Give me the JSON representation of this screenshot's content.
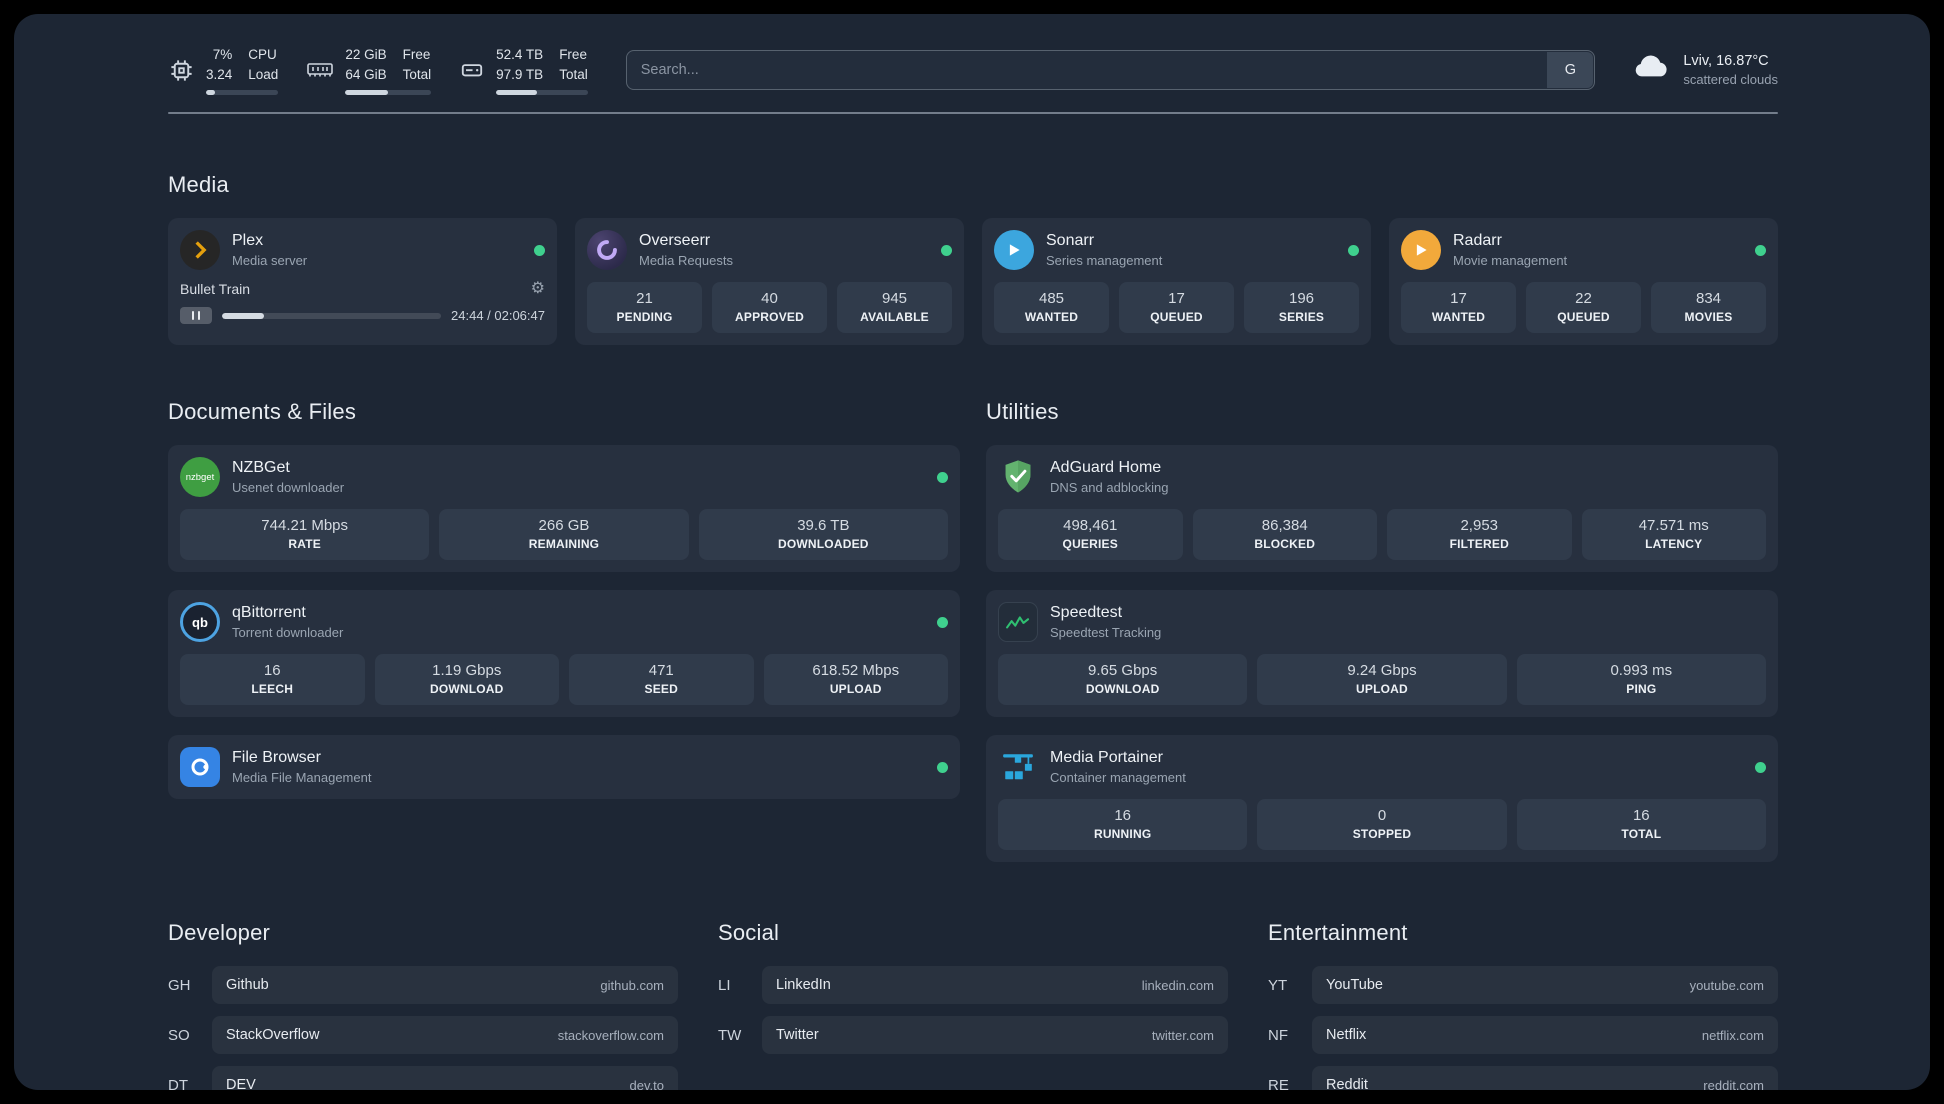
{
  "colors": {
    "status_online": "#3fd08e"
  },
  "topbar": {
    "cpu": {
      "icon": "cpu-icon",
      "line1": "7%",
      "line2": "3.24",
      "label1": "CPU",
      "label2": "Load",
      "progress": 12
    },
    "memory": {
      "icon": "memory-icon",
      "line1": "22 GiB",
      "line2": "64 GiB",
      "label1": "Free",
      "label2": "Total",
      "progress": 50
    },
    "disk": {
      "icon": "disk-icon",
      "line1": "52.4 TB",
      "line2": "97.9 TB",
      "label1": "Free",
      "label2": "Total",
      "progress": 45
    },
    "search": {
      "placeholder": "Search...",
      "provider_label": "G"
    },
    "weather": {
      "icon": "cloud-icon",
      "location": "Lviv, 16.87°C",
      "condition": "scattered clouds"
    }
  },
  "sections": {
    "media": {
      "title": "Media",
      "cards": [
        {
          "name": "Plex",
          "desc": "Media server",
          "icon": "plex-icon",
          "status": "online",
          "player": {
            "track": "Bullet Train",
            "time": "24:44 / 02:06:47",
            "progress": 19
          }
        },
        {
          "name": "Overseerr",
          "desc": "Media Requests",
          "icon": "overseerr-icon",
          "status": "online",
          "stats": [
            {
              "value": "21",
              "label": "PENDING"
            },
            {
              "value": "40",
              "label": "APPROVED"
            },
            {
              "value": "945",
              "label": "AVAILABLE"
            }
          ]
        },
        {
          "name": "Sonarr",
          "desc": "Series management",
          "icon": "sonarr-icon",
          "status": "online",
          "stats": [
            {
              "value": "485",
              "label": "WANTED"
            },
            {
              "value": "17",
              "label": "QUEUED"
            },
            {
              "value": "196",
              "label": "SERIES"
            }
          ]
        },
        {
          "name": "Radarr",
          "desc": "Movie management",
          "icon": "radarr-icon",
          "status": "online",
          "stats": [
            {
              "value": "17",
              "label": "WANTED"
            },
            {
              "value": "22",
              "label": "QUEUED"
            },
            {
              "value": "834",
              "label": "MOVIES"
            }
          ]
        }
      ]
    },
    "documents": {
      "title": "Documents & Files",
      "cards": [
        {
          "name": "NZBGet",
          "desc": "Usenet downloader",
          "icon": "nzbget-icon",
          "status": "online",
          "stats": [
            {
              "value": "744.21 Mbps",
              "label": "RATE"
            },
            {
              "value": "266 GB",
              "label": "REMAINING"
            },
            {
              "value": "39.6 TB",
              "label": "DOWNLOADED"
            }
          ]
        },
        {
          "name": "qBittorrent",
          "desc": "Torrent downloader",
          "icon": "qbittorrent-icon",
          "status": "online",
          "stats": [
            {
              "value": "16",
              "label": "LEECH"
            },
            {
              "value": "1.19 Gbps",
              "label": "DOWNLOAD"
            },
            {
              "value": "471",
              "label": "SEED"
            },
            {
              "value": "618.52 Mbps",
              "label": "UPLOAD"
            }
          ]
        },
        {
          "name": "File Browser",
          "desc": "Media File Management",
          "icon": "filebrowser-icon",
          "status": "online",
          "stats": []
        }
      ]
    },
    "utilities": {
      "title": "Utilities",
      "cards": [
        {
          "name": "AdGuard Home",
          "desc": "DNS and adblocking",
          "icon": "adguard-icon",
          "stats": [
            {
              "value": "498,461",
              "label": "QUERIES"
            },
            {
              "value": "86,384",
              "label": "BLOCKED"
            },
            {
              "value": "2,953",
              "label": "FILTERED"
            },
            {
              "value": "47.571 ms",
              "label": "LATENCY"
            }
          ]
        },
        {
          "name": "Speedtest",
          "desc": "Speedtest Tracking",
          "icon": "speedtest-icon",
          "stats": [
            {
              "value": "9.65 Gbps",
              "label": "DOWNLOAD"
            },
            {
              "value": "9.24 Gbps",
              "label": "UPLOAD"
            },
            {
              "value": "0.993 ms",
              "label": "PING"
            }
          ]
        },
        {
          "name": "Media Portainer",
          "desc": "Container management",
          "icon": "portainer-icon",
          "status": "online",
          "stats": [
            {
              "value": "16",
              "label": "RUNNING"
            },
            {
              "value": "0",
              "label": "STOPPED"
            },
            {
              "value": "16",
              "label": "TOTAL"
            }
          ]
        }
      ]
    }
  },
  "bookmarks": [
    {
      "title": "Developer",
      "items": [
        {
          "abbr": "GH",
          "name": "Github",
          "domain": "github.com"
        },
        {
          "abbr": "SO",
          "name": "StackOverflow",
          "domain": "stackoverflow.com"
        },
        {
          "abbr": "DT",
          "name": "DEV",
          "domain": "dev.to"
        }
      ]
    },
    {
      "title": "Social",
      "items": [
        {
          "abbr": "LI",
          "name": "LinkedIn",
          "domain": "linkedin.com"
        },
        {
          "abbr": "TW",
          "name": "Twitter",
          "domain": "twitter.com"
        }
      ]
    },
    {
      "title": "Entertainment",
      "items": [
        {
          "abbr": "YT",
          "name": "YouTube",
          "domain": "youtube.com"
        },
        {
          "abbr": "NF",
          "name": "Netflix",
          "domain": "netflix.com"
        },
        {
          "abbr": "RE",
          "name": "Reddit",
          "domain": "reddit.com"
        }
      ]
    }
  ]
}
